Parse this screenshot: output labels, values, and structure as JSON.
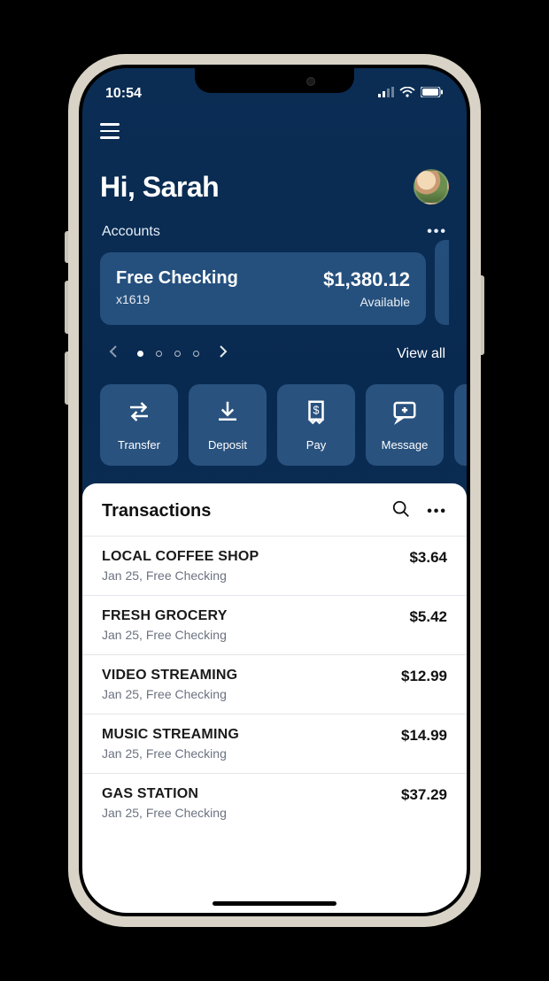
{
  "status": {
    "time": "10:54"
  },
  "header": {
    "greeting": "Hi, Sarah"
  },
  "accounts": {
    "label": "Accounts",
    "card": {
      "name": "Free Checking",
      "mask": "x1619",
      "balance": "$1,380.12",
      "balance_label": "Available"
    },
    "view_all": "View all"
  },
  "actions": {
    "transfer": "Transfer",
    "deposit": "Deposit",
    "pay": "Pay",
    "message": "Message"
  },
  "transactions": {
    "title": "Transactions",
    "items": [
      {
        "name": "LOCAL COFFEE SHOP",
        "sub": "Jan 25, Free Checking",
        "amount": "$3.64"
      },
      {
        "name": "FRESH GROCERY",
        "sub": "Jan 25, Free Checking",
        "amount": "$5.42"
      },
      {
        "name": "VIDEO STREAMING",
        "sub": "Jan 25, Free Checking",
        "amount": "$12.99"
      },
      {
        "name": "MUSIC STREAMING",
        "sub": "Jan 25, Free Checking",
        "amount": "$14.99"
      },
      {
        "name": "GAS STATION",
        "sub": "Jan 25, Free Checking",
        "amount": "$37.29"
      }
    ]
  }
}
